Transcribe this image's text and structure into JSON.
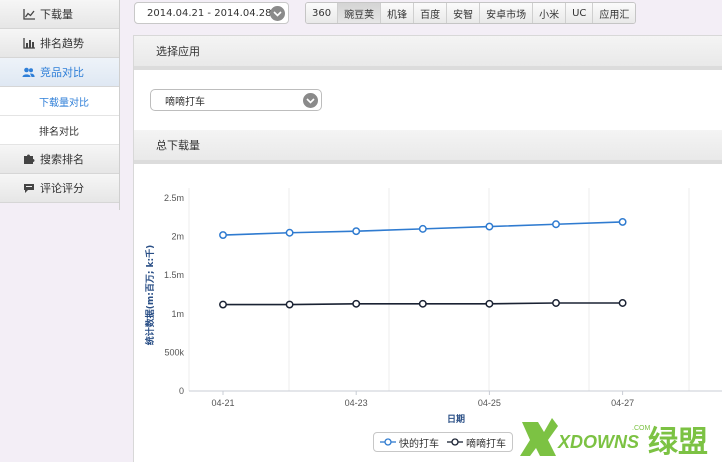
{
  "sidebar": {
    "items": [
      {
        "label": "下载量",
        "icon": "line-chart-icon"
      },
      {
        "label": "排名趋势",
        "icon": "bar-chart-icon"
      },
      {
        "label": "竞品对比",
        "icon": "users-icon",
        "active": true
      },
      {
        "label": "搜索排名",
        "icon": "puzzle-icon"
      },
      {
        "label": "评论评分",
        "icon": "comment-icon"
      }
    ],
    "subitems": [
      {
        "label": "下载量对比",
        "active": true
      },
      {
        "label": "排名对比"
      }
    ]
  },
  "date_range": {
    "value": "2014.04.21 - 2014.04.28"
  },
  "tabs": [
    {
      "label": "360"
    },
    {
      "label": "豌豆荚",
      "active": true
    },
    {
      "label": "机锋"
    },
    {
      "label": "百度"
    },
    {
      "label": "安智"
    },
    {
      "label": "安卓市场"
    },
    {
      "label": "小米"
    },
    {
      "label": "UC"
    },
    {
      "label": "应用汇"
    }
  ],
  "section_select_app": {
    "title": "选择应用",
    "selected": "嘀嘀打车"
  },
  "section_downloads": {
    "title": "总下载量"
  },
  "chart_data": {
    "type": "line",
    "x": [
      "04-21",
      "04-22",
      "04-23",
      "04-24",
      "04-25",
      "04-26",
      "04-27"
    ],
    "x_tick_labels": [
      "04-21",
      "04-23",
      "04-25",
      "04-27"
    ],
    "xlabel": "日期",
    "ylabel": "统计数据(m:百万; k:千)",
    "yticks": [
      {
        "value": 0,
        "label": "0"
      },
      {
        "value": 500000,
        "label": "500k"
      },
      {
        "value": 1000000,
        "label": "1m"
      },
      {
        "value": 1500000,
        "label": "1.5m"
      },
      {
        "value": 2000000,
        "label": "2m"
      },
      {
        "value": 2500000,
        "label": "2.5m"
      }
    ],
    "ylim": [
      0,
      2500000
    ],
    "grid": "vertical",
    "legend_position": "bottom",
    "series": [
      {
        "name": "快的打车",
        "color": "#2f7bd0",
        "values": [
          2020000,
          2050000,
          2070000,
          2100000,
          2130000,
          2160000,
          2190000
        ]
      },
      {
        "name": "嘀嘀打车",
        "color": "#1a2233",
        "values": [
          1120000,
          1120000,
          1130000,
          1130000,
          1130000,
          1140000,
          1140000
        ]
      }
    ]
  },
  "colors": {
    "accent": "#2f7fd8",
    "series1": "#2f7bd0",
    "series2": "#1a2233"
  },
  "watermark": {
    "text": "XDOWNS",
    "suffix": "绿盟",
    "sup": ".COM"
  }
}
